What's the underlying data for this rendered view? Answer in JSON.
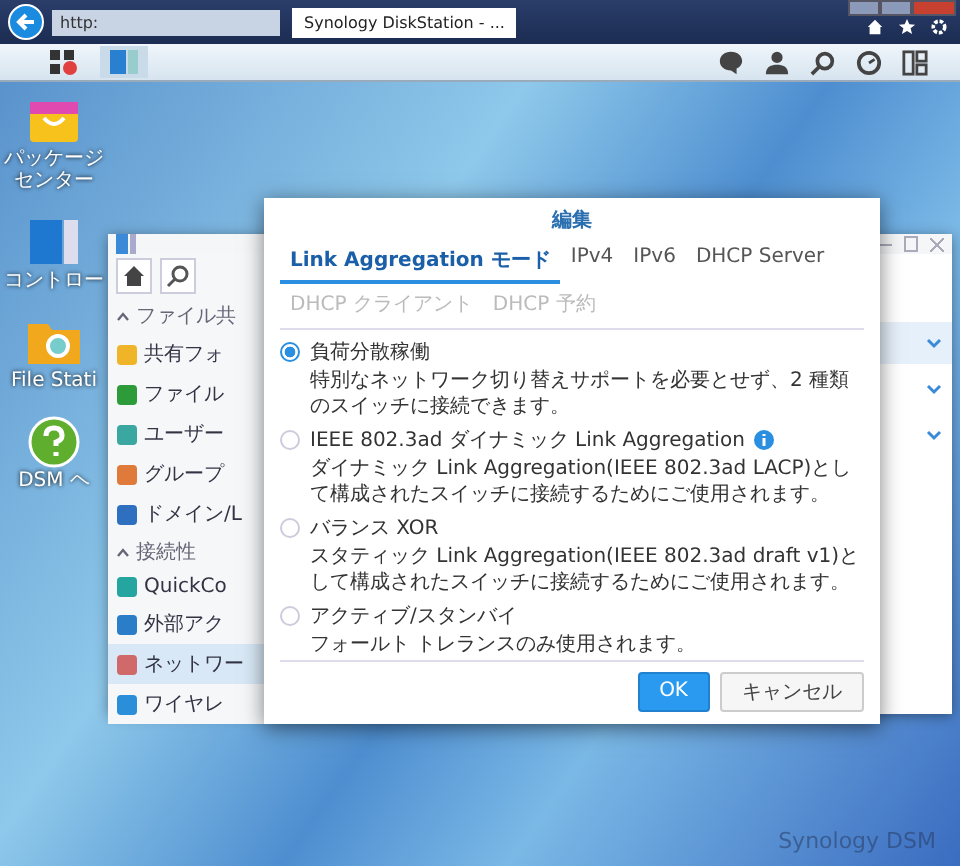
{
  "browser": {
    "address": "http:",
    "tab_title": "Synology DiskStation - ..."
  },
  "desktop_icons": [
    {
      "kind": "package",
      "label": "パッケージセンター"
    },
    {
      "kind": "control",
      "label": "コントロー"
    },
    {
      "kind": "folder",
      "label": "File Stati"
    },
    {
      "kind": "help",
      "label": "DSM ヘ"
    }
  ],
  "control_panel": {
    "sections": [
      {
        "title": "ファイル共",
        "expanded": true,
        "items": [
          {
            "label": "共有フォ",
            "selected": false
          },
          {
            "label": "ファイル",
            "selected": false
          },
          {
            "label": "ユーザー",
            "selected": false
          },
          {
            "label": "グループ",
            "selected": false
          },
          {
            "label": "ドメイン/L",
            "selected": false
          }
        ]
      },
      {
        "title": "接続性",
        "expanded": true,
        "items": [
          {
            "label": "QuickCo",
            "selected": false
          },
          {
            "label": "外部アク",
            "selected": false
          },
          {
            "label": "ネットワー",
            "selected": true
          },
          {
            "label": "ワイヤレ",
            "selected": false
          }
        ]
      }
    ],
    "rows": [
      {
        "selected": true
      },
      {
        "selected": false
      },
      {
        "selected": false
      }
    ]
  },
  "dialog": {
    "title": "編集",
    "tabs": [
      {
        "label": "Link Aggregation モード",
        "selected": true,
        "disabled": false
      },
      {
        "label": "IPv4",
        "selected": false,
        "disabled": false
      },
      {
        "label": "IPv6",
        "selected": false,
        "disabled": false
      },
      {
        "label": "DHCP Server",
        "selected": false,
        "disabled": false
      },
      {
        "label": "DHCP クライアント",
        "selected": false,
        "disabled": true
      },
      {
        "label": "DHCP 予約",
        "selected": false,
        "disabled": true
      }
    ],
    "options": [
      {
        "label": "負荷分散稼働",
        "info": false,
        "selected": true,
        "description": "特別なネットワーク切り替えサポートを必要とせず、2 種類のスイッチに接続できます。"
      },
      {
        "label": "IEEE 802.3ad ダイナミック Link Aggregation",
        "info": true,
        "selected": false,
        "description": "ダイナミック Link Aggregation(IEEE 802.3ad LACP)として構成されたスイッチに接続するためにご使用されます。"
      },
      {
        "label": "バランス XOR",
        "info": false,
        "selected": false,
        "description": "スタティック Link Aggregation(IEEE 802.3ad draft v1)として構成されたスイッチに接続するためにご使用されます。"
      },
      {
        "label": "アクティブ/スタンバイ",
        "info": false,
        "selected": false,
        "description": "フォールト トレランスのみ使用されます。"
      }
    ],
    "buttons": [
      {
        "label": "OK",
        "kind": "primary"
      },
      {
        "label": "キャンセル",
        "kind": "secondary"
      }
    ]
  },
  "wallpaper_logo": "Synology DSM"
}
